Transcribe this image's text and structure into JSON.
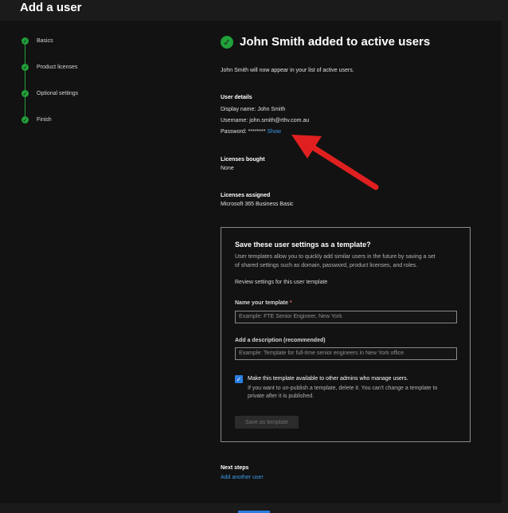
{
  "panel": {
    "title": "Add a user"
  },
  "steps": [
    {
      "label": "Basics"
    },
    {
      "label": "Product licenses"
    },
    {
      "label": "Optional settings"
    },
    {
      "label": "Finish"
    }
  ],
  "success": {
    "title": "John Smith added to active users",
    "message": "John Smith will now appear in your list of active users."
  },
  "user_details": {
    "heading": "User details",
    "display_name_label": "Display name:",
    "display_name": "John Smith",
    "username_label": "Username:",
    "username": "john.smith@rthv.com.au",
    "password_label": "Password:",
    "password_mask": "********",
    "show_link": "Show"
  },
  "licenses_bought": {
    "heading": "Licenses bought",
    "value": "None"
  },
  "licenses_assigned": {
    "heading": "Licenses assigned",
    "value": "Microsoft 365 Business Basic"
  },
  "template_card": {
    "title": "Save these user settings as a template?",
    "desc_line1": "User templates allow you to quickly add similar users in the future by saving a set",
    "desc_line2": "of shared settings such as domain, password, product licenses, and roles.",
    "review_link": "Review settings for this user template",
    "name_label": "Name your template",
    "name_required": "*",
    "name_placeholder": "Example: FTE Senior Engineer, New York",
    "desc_label": "Add a description (recommended)",
    "desc_placeholder": "Example: Template for full-time senior engineers in New York office",
    "checkbox_label": "Make this template available to other admins who manage users.",
    "checkbox_help1": "If you want to un-publish a template, delete it. You can't change a template to",
    "checkbox_help2": "private after it is published.",
    "save_button": "Save as template"
  },
  "next_steps": {
    "heading": "Next steps",
    "add_another": "Add another user"
  },
  "colors": {
    "success": "#22a03a",
    "accent": "#2a7de1",
    "link": "#3b9be8",
    "annotation": "#e02020"
  }
}
